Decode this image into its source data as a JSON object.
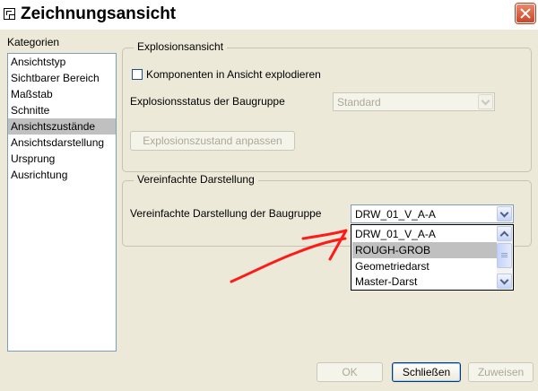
{
  "window": {
    "title": "Zeichnungsansicht",
    "icons": {
      "app": "view-window-icon",
      "close": "close-icon"
    }
  },
  "categories": {
    "label": "Kategorien",
    "items": [
      {
        "label": "Ansichtstyp"
      },
      {
        "label": "Sichtbarer Bereich"
      },
      {
        "label": "Maßstab"
      },
      {
        "label": "Schnitte"
      },
      {
        "label": "Ansichtszustände"
      },
      {
        "label": "Ansichtsdarstellung"
      },
      {
        "label": "Ursprung"
      },
      {
        "label": "Ausrichtung"
      }
    ],
    "selected_index": 4
  },
  "explosion": {
    "legend": "Explosionsansicht",
    "checkbox_label": "Komponenten in Ansicht explodieren",
    "checkbox_checked": false,
    "status_label": "Explosionsstatus der Baugruppe",
    "status_value": "Standard",
    "adjust_button": "Explosionszustand anpassen"
  },
  "simplified": {
    "legend": "Vereinfachte Darstellung",
    "rep_label": "Vereinfachte Darstellung der Baugruppe",
    "rep_value": "DRW_01_V_A-A",
    "options": [
      {
        "label": "DRW_01_V_A-A"
      },
      {
        "label": "ROUGH-GROB"
      },
      {
        "label": "Geometriedarst"
      },
      {
        "label": "Master-Darst"
      }
    ],
    "highlighted_index": 1
  },
  "buttons": {
    "ok": "OK",
    "close": "Schließen",
    "apply": "Zuweisen"
  },
  "colors": {
    "annotation": "#ff1a1a",
    "selection": "#c0c0c0",
    "close_button": "#c74728"
  }
}
